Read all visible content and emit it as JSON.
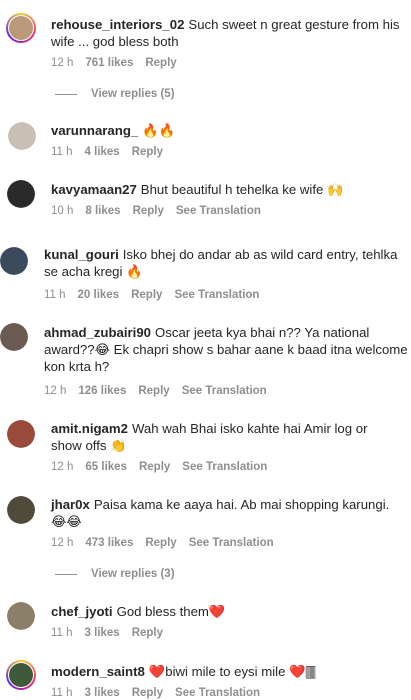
{
  "comments": [
    {
      "user": "rehouse_interiors_02",
      "text": "Such sweet n great gesture from his wife ... god bless both",
      "time": "12 h",
      "likes": "761 likes",
      "reply": "Reply",
      "translate": "",
      "replies": "View replies (5)",
      "avatar_color": "#b89a7a"
    },
    {
      "user": "varunnarang_",
      "text": "🔥🔥",
      "time": "11 h",
      "likes": "4 likes",
      "reply": "Reply",
      "translate": "",
      "replies": "",
      "avatar_color": "#c9c0b5"
    },
    {
      "user": "kavyamaan27",
      "text": "Bhut beautiful h tehelka ke wife 🙌",
      "time": "10 h",
      "likes": "8 likes",
      "reply": "Reply",
      "translate": "See Translation",
      "replies": "",
      "avatar_color": "#2a2a2a"
    },
    {
      "user": "kunal_gouri",
      "text": "Isko bhej do andar ab as wild card entry, tehlka se acha kregi 🔥",
      "time": "11 h",
      "likes": "20 likes",
      "reply": "Reply",
      "translate": "See Translation",
      "replies": "",
      "avatar_color": "#3b4a5c"
    },
    {
      "user": "ahmad_zubairi90",
      "text": "Oscar jeeta kya bhai n?? Ya national award??😂 Ek chapri show s bahar aane k baad itna welcome kon krta h?",
      "time": "12 h",
      "likes": "126 likes",
      "reply": "Reply",
      "translate": "See Translation",
      "replies": "",
      "avatar_color": "#6b5a52"
    },
    {
      "user": "amit.nigam2",
      "text": "Wah wah Bhai isko kahte hai Amir log or show offs 👏",
      "time": "12 h",
      "likes": "65 likes",
      "reply": "Reply",
      "translate": "See Translation",
      "replies": "",
      "avatar_color": "#9a4a3a"
    },
    {
      "user": "jhar0x",
      "text": "Paisa kama ke aaya hai. Ab mai shopping karungi.😂😂",
      "time": "12 h",
      "likes": "473 likes",
      "reply": "Reply",
      "translate": "See Translation",
      "replies": "View replies (3)",
      "avatar_color": "#4f4a3a"
    },
    {
      "user": "chef_jyoti",
      "text": "God bless them❤️",
      "time": "11 h",
      "likes": "3 likes",
      "reply": "Reply",
      "translate": "",
      "replies": "",
      "avatar_color": "#8c7f6a"
    },
    {
      "user": "modern_saint8",
      "text": "❤️biwi mile to eysi mile ❤️🀫",
      "time": "11 h",
      "likes": "3 likes",
      "reply": "Reply",
      "translate": "See Translation",
      "replies": "",
      "avatar_color": "#3e5a3a"
    }
  ]
}
